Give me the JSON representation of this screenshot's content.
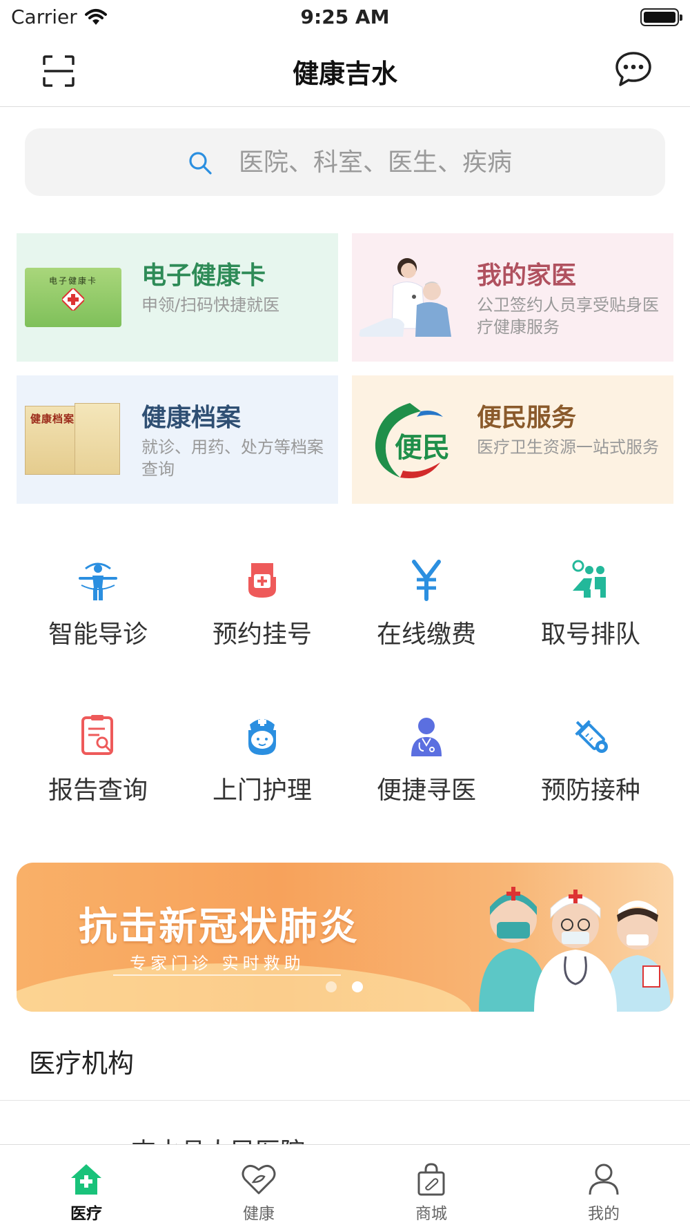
{
  "status_bar": {
    "carrier": "Carrier",
    "time": "9:25 AM"
  },
  "nav": {
    "title": "健康吉水"
  },
  "search": {
    "placeholder": "医院、科室、医生、疾病"
  },
  "cards": [
    {
      "title": "电子健康卡",
      "desc": "申领/扫码快捷就医",
      "title_color": "#2e8b57",
      "bg": "#e7f6ee",
      "card_text": "电子健康卡"
    },
    {
      "title": "我的家医",
      "desc": "公卫签约人员享受贴身医疗健康服务",
      "title_color": "#b0515f",
      "bg": "#fbeef2"
    },
    {
      "title": "健康档案",
      "desc": "就诊、用药、处方等档案查询",
      "title_color": "#2f4f73",
      "bg": "#edf3fb",
      "folder_text": "健康档案"
    },
    {
      "title": "便民服务",
      "desc": "医疗卫生资源一站式服务",
      "title_color": "#8a5a2b",
      "bg": "#fdf2e2",
      "logo_text": "便民"
    }
  ],
  "services": [
    {
      "label": "智能导诊",
      "icon": "body-guide-icon",
      "color": "#2b8fe0"
    },
    {
      "label": "预约挂号",
      "icon": "hand-register-icon",
      "color": "#ee5a5a"
    },
    {
      "label": "在线缴费",
      "icon": "yuan-payment-icon",
      "color": "#2b8fe0"
    },
    {
      "label": "取号排队",
      "icon": "queue-icon",
      "color": "#23b89a"
    },
    {
      "label": "报告查询",
      "icon": "report-search-icon",
      "color": "#ee5a5a"
    },
    {
      "label": "上门护理",
      "icon": "nurse-icon",
      "color": "#2b8fe0"
    },
    {
      "label": "便捷寻医",
      "icon": "doctor-icon",
      "color": "#5b6fe0"
    },
    {
      "label": "预防接种",
      "icon": "vaccine-icon",
      "color": "#2b8fe0"
    }
  ],
  "banner": {
    "title": "抗击新冠状肺炎",
    "subtitle": "专家门诊  实时救助",
    "slide_count": 2,
    "active_slide": 1
  },
  "section": {
    "title": "医疗机构",
    "first_item_peek": "吉水县人民医院"
  },
  "tabs": [
    {
      "label": "医疗",
      "icon": "medical-home-icon",
      "active": true
    },
    {
      "label": "健康",
      "icon": "heart-icon",
      "active": false
    },
    {
      "label": "商城",
      "icon": "shopping-bag-icon",
      "active": false
    },
    {
      "label": "我的",
      "icon": "user-icon",
      "active": false
    }
  ],
  "colors": {
    "accent_green": "#19c27a",
    "accent_blue": "#2b8fe0"
  }
}
